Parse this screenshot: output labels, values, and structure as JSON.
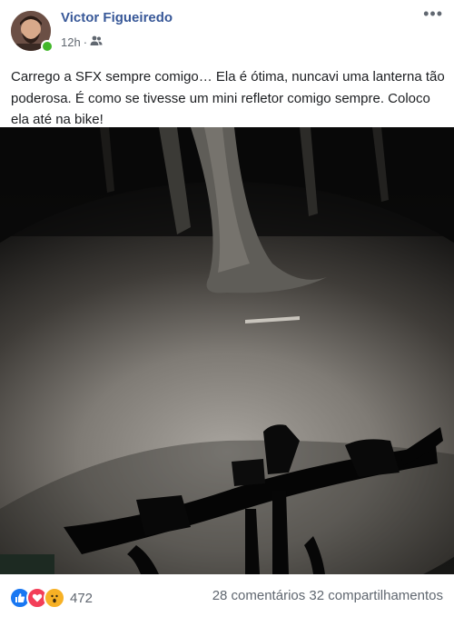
{
  "post": {
    "author": "Victor Figueiredo",
    "time": "12h",
    "separator": "·",
    "audience_icon": "friends-icon",
    "more_icon": "more-options-icon",
    "text": "Carrego a SFX sempre comigo… Ela é ótima, nuncavi uma lanterna tão poderosa. É como se tivesse um mini refletor comigo sempre. Coloco ela até na bike!"
  },
  "photo": {
    "description_icon": "night-forest-bike-light-photo"
  },
  "footer": {
    "reaction_icons": [
      "like-icon",
      "love-icon",
      "wow-icon"
    ],
    "reaction_count": "472",
    "comments": "28 comentários",
    "shares": "32 compartilhamentos"
  },
  "colors": {
    "name_link": "#385898",
    "meta_gray": "#606770",
    "like_blue": "#1877f2",
    "love_red": "#f33e58",
    "wow_yellow": "#f7b125",
    "online_green": "#42b72a"
  }
}
